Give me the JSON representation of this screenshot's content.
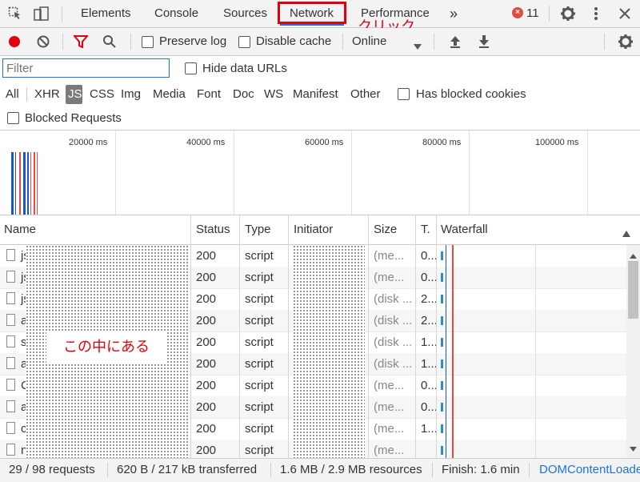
{
  "tabs": {
    "elements": "Elements",
    "console": "Console",
    "sources": "Sources",
    "network": "Network",
    "performance": "Performance",
    "more": "»",
    "error_count": "11",
    "error_badge": "×"
  },
  "annotations": {
    "click": "クリック",
    "inside": "この中にある"
  },
  "toolbar": {
    "preserve_log": "Preserve log",
    "disable_cache": "Disable cache",
    "throttling": "Online"
  },
  "filter": {
    "placeholder": "Filter",
    "hide_data_urls": "Hide data URLs"
  },
  "type_filters": [
    "All",
    "XHR",
    "JS",
    "CSS",
    "Img",
    "Media",
    "Font",
    "Doc",
    "WS",
    "Manifest",
    "Other"
  ],
  "has_blocked_cookies": "Has blocked cookies",
  "blocked_requests": "Blocked Requests",
  "overview": {
    "labels": [
      "20000 ms",
      "40000 ms",
      "60000 ms",
      "80000 ms",
      "100000 ms"
    ]
  },
  "table": {
    "columns": {
      "name": "Name",
      "status": "Status",
      "type": "Type",
      "initiator": "Initiator",
      "size": "Size",
      "time": "T.",
      "waterfall": "Waterfall"
    },
    "rows": [
      {
        "name": "js",
        "status": "200",
        "type": "script",
        "size": "(me...",
        "time": "0..."
      },
      {
        "name": "js",
        "status": "200",
        "type": "script",
        "size": "(me...",
        "time": "0..."
      },
      {
        "name": "js",
        "status": "200",
        "type": "script",
        "size": "(disk ...",
        "time": "2..."
      },
      {
        "name": "a",
        "status": "200",
        "type": "script",
        "size": "(disk ...",
        "time": "2..."
      },
      {
        "name": "s",
        "status": "200",
        "type": "script",
        "size": "(disk ...",
        "time": "1..."
      },
      {
        "name": "a",
        "status": "200",
        "type": "script",
        "size": "(disk ...",
        "time": "1..."
      },
      {
        "name": "C",
        "status": "200",
        "type": "script",
        "size": "(me...",
        "time": "0..."
      },
      {
        "name": "a",
        "status": "200",
        "type": "script",
        "size": "(me...",
        "time": "0..."
      },
      {
        "name": "c",
        "status": "200",
        "type": "script",
        "size": "(me...",
        "time": "1..."
      },
      {
        "name": "n",
        "status": "200",
        "type": "script",
        "size": "(me...",
        "time": ""
      }
    ]
  },
  "status": {
    "requests": "29 / 98 requests",
    "transferred": "620 B / 217 kB transferred",
    "resources": "1.6 MB / 2.9 MB resources",
    "finish": "Finish: 1.6 min",
    "domcontentloaded": "DOMContentLoaded"
  },
  "colors": {
    "accent": "#1a73e8",
    "record": "#e3000f",
    "annotation": "#e3000f"
  }
}
